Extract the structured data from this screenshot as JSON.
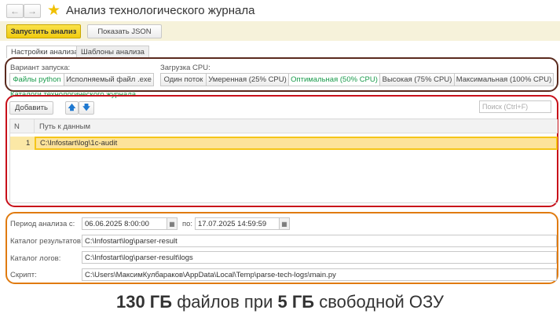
{
  "window": {
    "title": "Анализ технологического журнала",
    "back": "←",
    "forward": "→"
  },
  "toolbar": {
    "run": "Запустить анализ",
    "show_json": "Показать JSON"
  },
  "tabs": [
    {
      "label": "Настройки анализа"
    },
    {
      "label": "Шаблоны анализа"
    }
  ],
  "launch": {
    "label": "Вариант запуска:",
    "options": [
      "Файлы python",
      "Исполняемый файл .exe"
    ],
    "selected": "Файлы python"
  },
  "cpu": {
    "label": "Загрузка CPU:",
    "options": [
      "Один поток",
      "Умеренная (25% CPU)",
      "Оптимальная (50% CPU)",
      "Высокая (75% CPU)",
      "Максимальная (100% CPU)"
    ],
    "selected": "Оптимальная (50% CPU)"
  },
  "catalogs": {
    "title": "Каталоги технологического журнала",
    "add": "Добавить",
    "search_placeholder": "Поиск (Ctrl+F)",
    "columns": [
      "N",
      "Путь к данным"
    ],
    "rows": [
      {
        "n": "1",
        "path": "C:\\Infostart\\log\\1c-audit"
      }
    ]
  },
  "params": {
    "period_label": "Период анализа с:",
    "from": "06.06.2025  8:00:00",
    "to_label": "по:",
    "to": "17.07.2025 14:59:59",
    "results_label": "Каталог результатов:",
    "results": "C:\\Infostart\\log\\parser-result",
    "logs_label": "Каталог логов:",
    "logs": "C:\\Infostart\\log\\parser-result\\logs",
    "script_label": "Скрипт:",
    "script": "C:\\Users\\МаксимКулбараков\\AppData\\Local\\Temp\\parse-tech-logs\\main.py"
  },
  "caption": {
    "part1": "130 ГБ",
    "part2": " файлов при ",
    "part3": "5 ГБ",
    "part4": " свободной ОЗУ"
  },
  "colors": {
    "brown": "#5a2a1e",
    "red": "#c8101a",
    "orange": "#e07b10",
    "accent": "#1a9b4c"
  }
}
